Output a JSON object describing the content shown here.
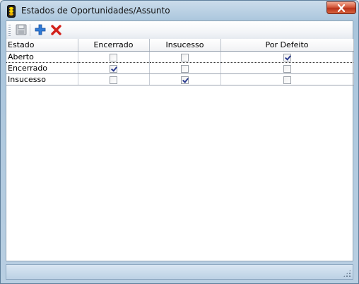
{
  "window": {
    "title": "Estados de Oportunidades/Assunto"
  },
  "toolbar": {
    "buttons": [
      {
        "icon": "save-icon",
        "enabled": false
      },
      {
        "icon": "add-icon",
        "enabled": true
      },
      {
        "icon": "delete-icon",
        "enabled": true
      }
    ]
  },
  "grid": {
    "columns": [
      "Estado",
      "Encerrado",
      "Insucesso",
      "Por Defeito"
    ],
    "rows": [
      {
        "estado": "Aberto",
        "encerrado": false,
        "insucesso": false,
        "por_defeito": true
      },
      {
        "estado": "Encerrado",
        "encerrado": true,
        "insucesso": false,
        "por_defeito": false
      },
      {
        "estado": "Insucesso",
        "encerrado": false,
        "insucesso": true,
        "por_defeito": false
      }
    ]
  },
  "colors": {
    "close_button": "#c8442a",
    "add_icon": "#2f7bd8",
    "delete_icon": "#d2201a"
  }
}
